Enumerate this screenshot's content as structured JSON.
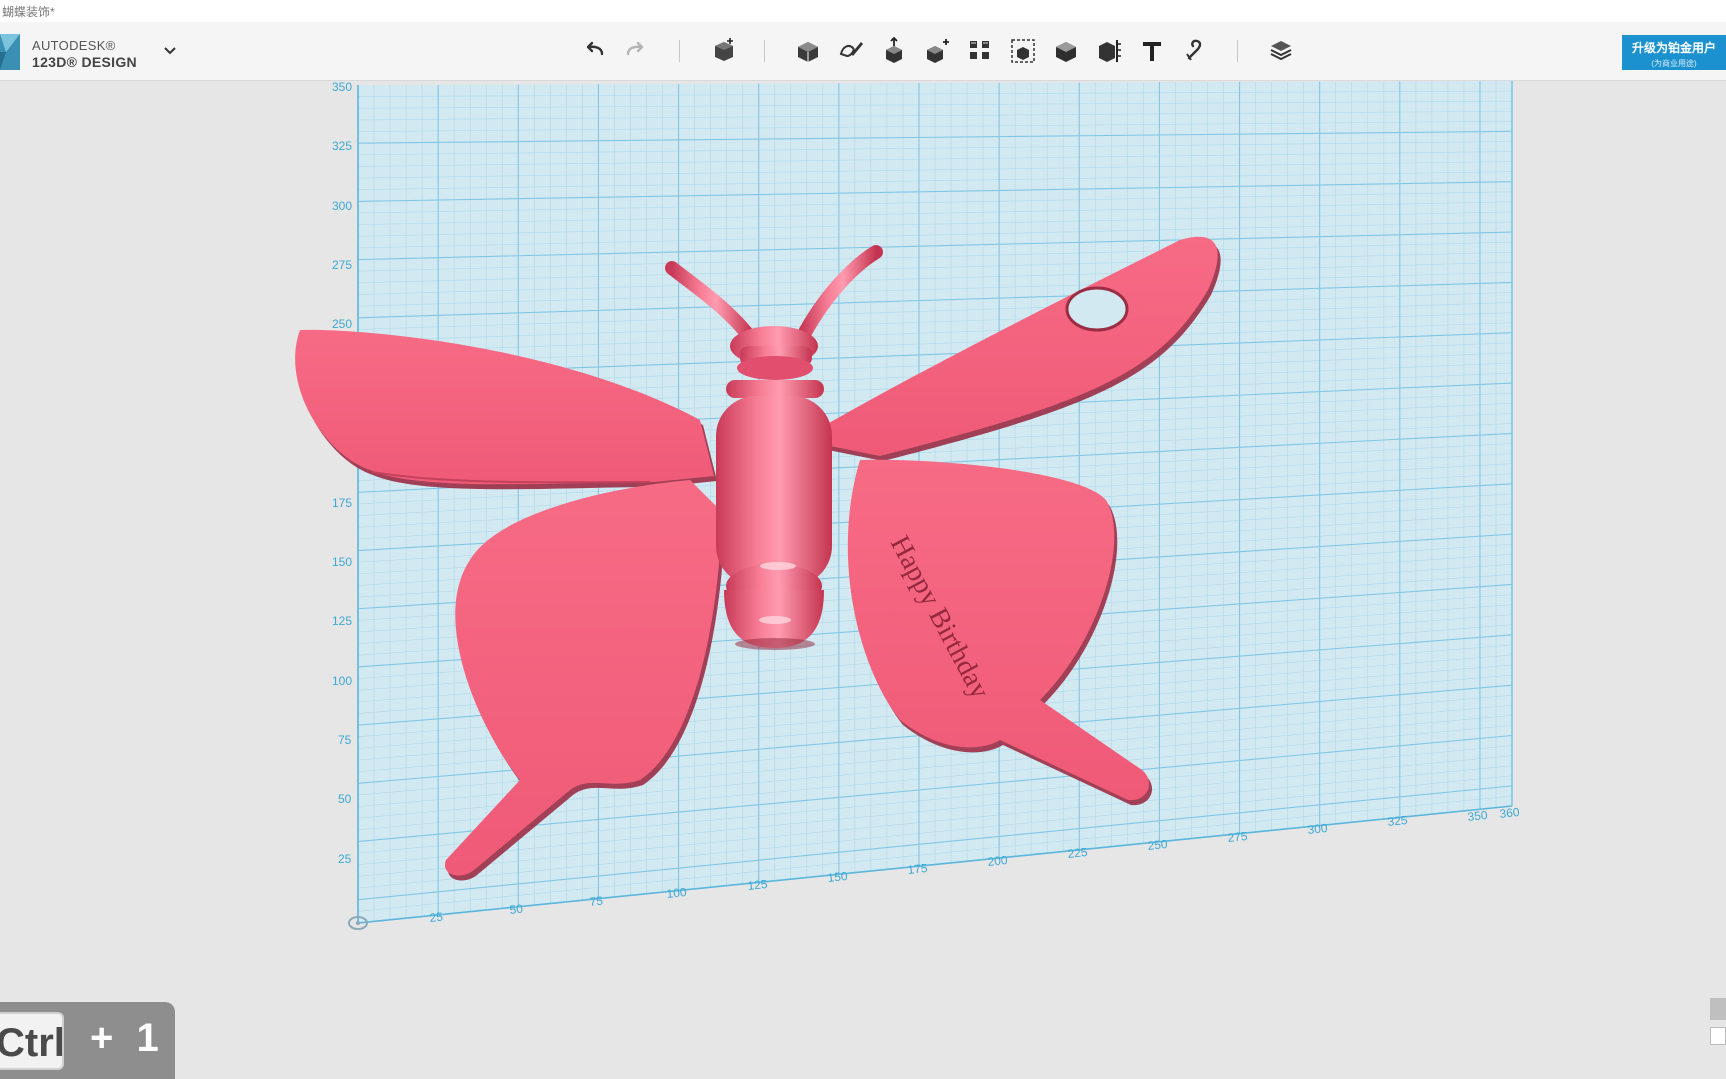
{
  "window": {
    "title": "蝴蝶装饰*"
  },
  "brand": {
    "line1": "AUTODESK®",
    "line2": "123D® DESIGN"
  },
  "toolbar": {
    "tools": [
      {
        "id": "undo",
        "icon": "undo-icon"
      },
      {
        "id": "redo",
        "icon": "redo-icon"
      },
      {
        "id": "transform",
        "icon": "transform-icon"
      },
      {
        "id": "primitives",
        "icon": "primitives-icon"
      },
      {
        "id": "sketch",
        "icon": "sketch-icon"
      },
      {
        "id": "construct",
        "icon": "construct-icon"
      },
      {
        "id": "modify",
        "icon": "modify-icon"
      },
      {
        "id": "pattern",
        "icon": "pattern-icon"
      },
      {
        "id": "grouping",
        "icon": "grouping-icon"
      },
      {
        "id": "combine",
        "icon": "combine-icon"
      },
      {
        "id": "measure",
        "icon": "measure-icon"
      },
      {
        "id": "text",
        "icon": "text-icon"
      },
      {
        "id": "snap",
        "icon": "snap-icon"
      },
      {
        "id": "materials",
        "icon": "materials-icon"
      }
    ],
    "upgrade_label": "升级为铂金用户",
    "upgrade_sub": "(为商业用途)"
  },
  "grid": {
    "y_ticks": [
      "25",
      "50",
      "75",
      "100",
      "125",
      "150",
      "175",
      "250",
      "275",
      "300",
      "325",
      "350"
    ],
    "x_ticks": [
      "25",
      "50",
      "75",
      "100",
      "125",
      "150",
      "175",
      "200",
      "225",
      "250",
      "275",
      "300",
      "325",
      "350",
      "360"
    ]
  },
  "model": {
    "engraved_text": "Happy Birthday",
    "color": "#f4637f"
  },
  "shortcut": {
    "key": "Ctrl",
    "rest": "+ 1"
  }
}
